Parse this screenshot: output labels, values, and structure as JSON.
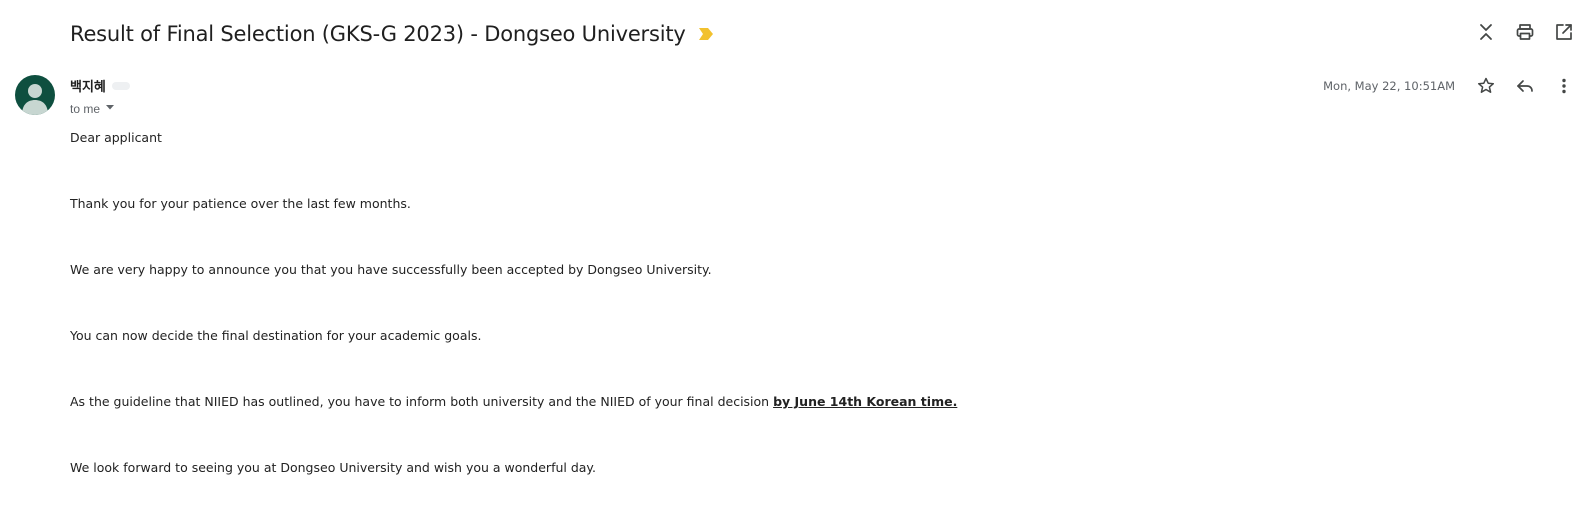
{
  "email": {
    "subject": "Result of Final Selection (GKS-G 2023) - Dongseo University",
    "importance_icon": "importance-marker-icon",
    "actions": [
      {
        "name": "collapse-all-icon"
      },
      {
        "name": "print-icon"
      },
      {
        "name": "open-in-new-window-icon"
      }
    ],
    "sender": {
      "name": "백지혜",
      "avatar_color": "#0e4f3f"
    },
    "to_label": "to me",
    "date": "Mon, May 22, 10:51AM",
    "body": {
      "greeting": "Dear applicant",
      "p1": "Thank you for your patience over the last few months.",
      "p2": "We are very happy to announce you that you have successfully been accepted by Dongseo University.",
      "p3": "You can now decide the final destination for your academic goals.",
      "p4_prefix": "As the guideline that NIIED has outlined, you have to inform both university and the NIIED of your final decision ",
      "p4_deadline": "by June 14th Korean time.",
      "p5": "We look forward to seeing you at Dongseo University and wish you a wonderful day."
    }
  },
  "colors": {
    "importance": "#f2c12e",
    "icon": "#444746",
    "muted_text": "#5f6368"
  }
}
